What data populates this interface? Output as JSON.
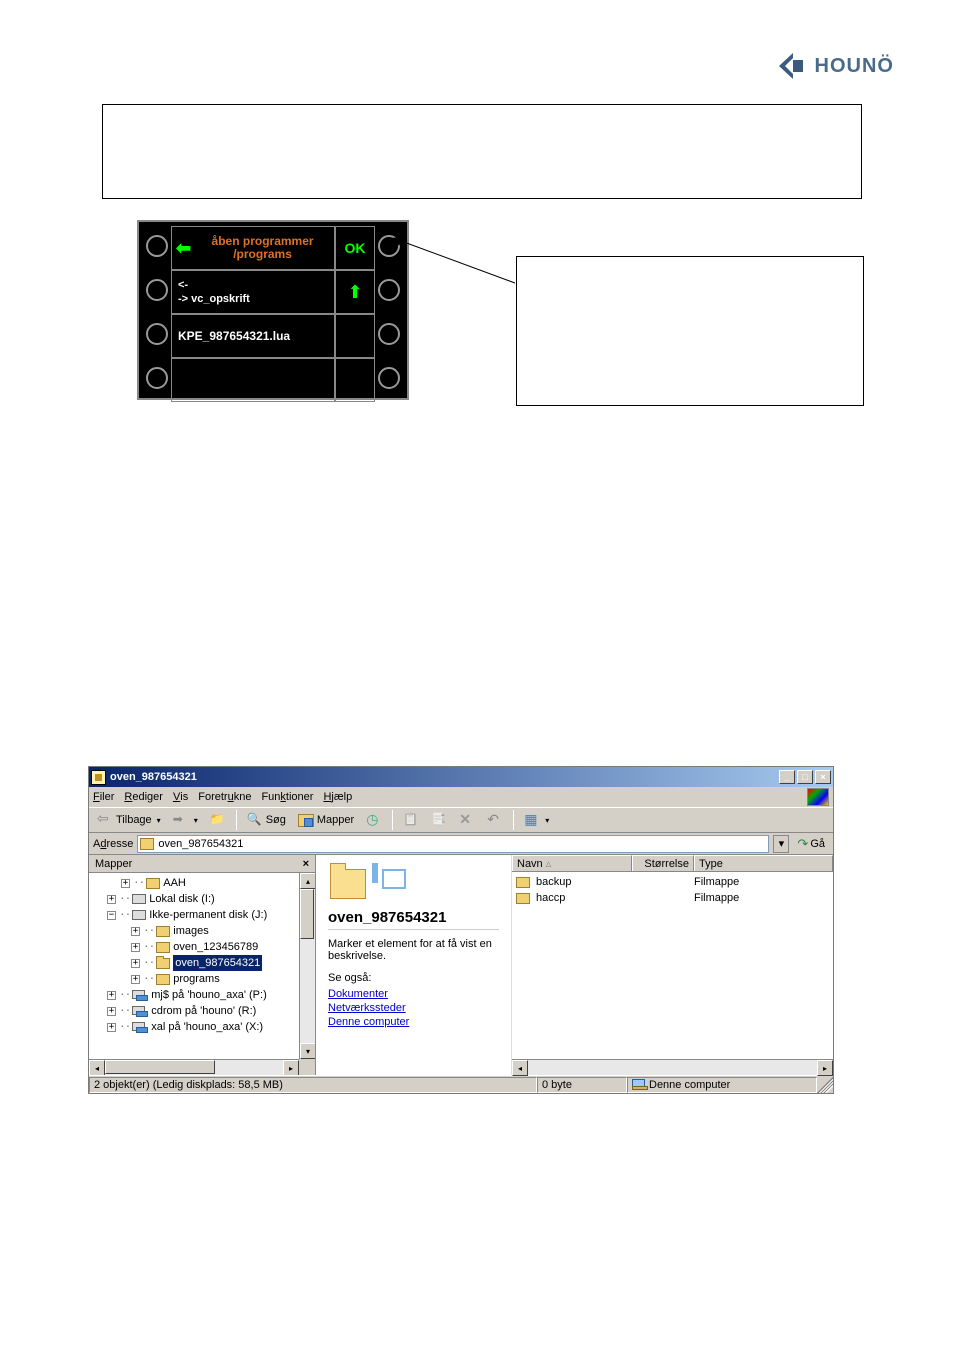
{
  "logo_text": "HOUNÖ",
  "panel": {
    "header_line1": "åben programmer",
    "header_line2": "/programs",
    "ok": "OK",
    "line_back": "<-",
    "line_vc": "-> vc_opskrift",
    "line_file": "KPE_987654321.lua"
  },
  "explorer": {
    "title": "oven_987654321",
    "menus": {
      "filer": "Filer",
      "rediger": "Rediger",
      "vis": "Vis",
      "foretrukne": "Foretrukne",
      "funktioner": "Funktioner",
      "hjaelp": "Hjælp"
    },
    "toolbar": {
      "tilbage": "Tilbage",
      "soeg": "Søg",
      "mapper": "Mapper"
    },
    "address_label": "Adresse",
    "address_value": "oven_987654321",
    "go_label": "Gå",
    "folders_header": "Mapper",
    "tree": {
      "aah": "AAH",
      "lokal": "Lokal disk (I:)",
      "ikkeperm": "Ikke-permanent disk (J:)",
      "images": "images",
      "oven1": "oven_123456789",
      "oven2": "oven_987654321",
      "programs": "programs",
      "mjs": "mj$ på 'houno_axa' (P:)",
      "cdrom": "cdrom på 'houno' (R:)",
      "xal": "xal på 'houno_axa' (X:)"
    },
    "webview": {
      "title": "oven_987654321",
      "desc": "Marker et element for at få vist en beskrivelse.",
      "see_also": "Se også:",
      "link1": "Dokumenter",
      "link2": "Netværkssteder",
      "link3": "Denne computer"
    },
    "columns": {
      "navn": "Navn",
      "stoerrelse": "Størrelse",
      "type": "Type"
    },
    "rows": [
      {
        "name": "backup",
        "type": "Filmappe"
      },
      {
        "name": "haccp",
        "type": "Filmappe"
      }
    ],
    "status_left": "2 objekt(er) (Ledig diskplads: 58,5 MB)",
    "status_mid": "0 byte",
    "status_right": "Denne computer"
  }
}
